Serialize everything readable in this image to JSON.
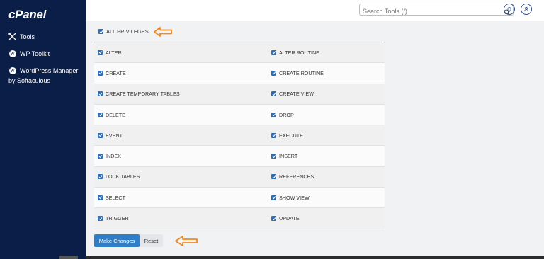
{
  "app": {
    "logo_text": "cPanel"
  },
  "sidebar": {
    "items": [
      {
        "label": "Tools",
        "icon": "tools-icon"
      },
      {
        "label": "WP Toolkit",
        "icon": "wordpress-icon"
      },
      {
        "label": "WordPress Manager",
        "icon": "wordpress-icon"
      }
    ],
    "sub_label": "by Softaculous"
  },
  "header": {
    "search_placeholder": "Search Tools (/)"
  },
  "privileges": {
    "all_label": "ALL PRIVILEGES",
    "all_checked": true,
    "rows": [
      {
        "left": "ALTER",
        "right": "ALTER ROUTINE"
      },
      {
        "left": "CREATE",
        "right": "CREATE ROUTINE"
      },
      {
        "left": "CREATE TEMPORARY TABLES",
        "right": "CREATE VIEW"
      },
      {
        "left": "DELETE",
        "right": "DROP"
      },
      {
        "left": "EVENT",
        "right": "EXECUTE"
      },
      {
        "left": "INDEX",
        "right": "INSERT"
      },
      {
        "left": "LOCK TABLES",
        "right": "REFERENCES"
      },
      {
        "left": "SELECT",
        "right": "SHOW VIEW"
      },
      {
        "left": "TRIGGER",
        "right": "UPDATE"
      }
    ]
  },
  "actions": {
    "make_changes_label": "Make Changes",
    "reset_label": "Reset"
  },
  "colors": {
    "sidebar_bg": "#0b1e47",
    "accent_blue": "#2f7fc8",
    "checkbox_blue": "#2f6db5",
    "annotation_arrow": "#f08a24"
  }
}
